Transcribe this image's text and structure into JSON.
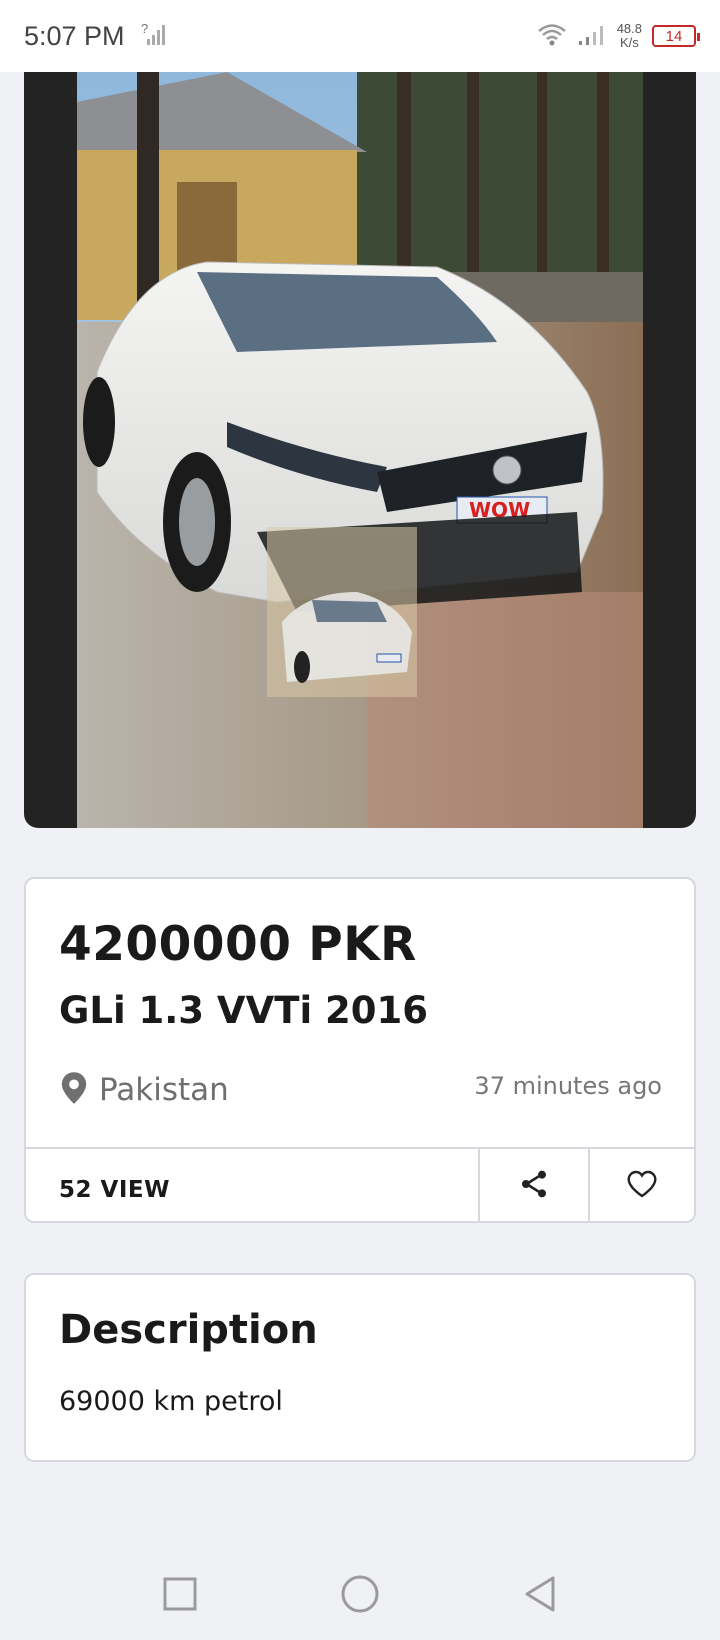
{
  "status_bar": {
    "time": "5:07 PM",
    "net_speed_value": "48.8",
    "net_speed_unit": "K/s",
    "battery": "14"
  },
  "listing": {
    "price": "4200000 PKR",
    "title": "GLi 1.3 VVTi 2016",
    "location": "Pakistan",
    "posted": "37 minutes ago",
    "views": "52 VIEW",
    "icons": {
      "location": "location-pin-icon",
      "share": "share-icon",
      "favorite": "heart-icon"
    }
  },
  "description": {
    "heading": "Description",
    "text": "69000 km petrol"
  },
  "photo_badge": "WOW",
  "colors": {
    "background": "#f0f1f5",
    "card": "#ffffff",
    "border": "#d6d8de",
    "battery": "#c62828"
  }
}
